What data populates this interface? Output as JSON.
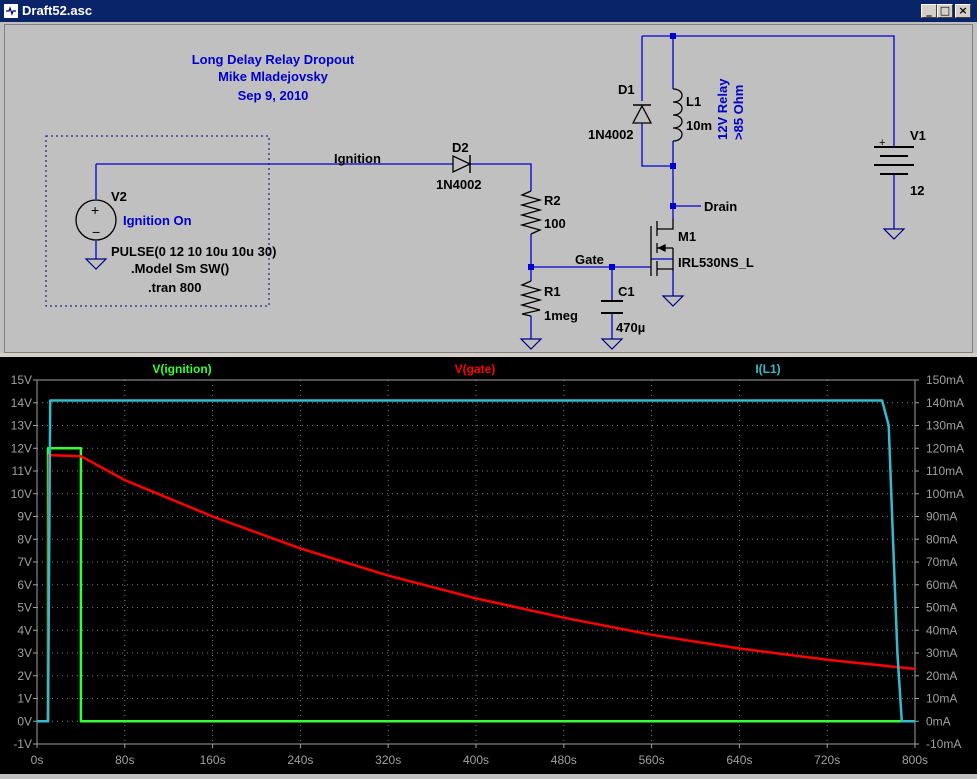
{
  "window": {
    "title": "Draft52.asc",
    "buttons": [
      "_",
      "□",
      "×"
    ]
  },
  "schematic": {
    "notes": [
      "Long Delay Relay Dropout",
      "Mike Mladejovsky",
      "Sep 9, 2010"
    ],
    "directives": [
      "PULSE(0 12 10 10u 10u 30)",
      ".Model Sm SW()",
      ".tran 800"
    ],
    "nets": {
      "ignition": "Ignition",
      "gate": "Gate",
      "drain": "Drain"
    },
    "components": {
      "v2": {
        "name": "V2",
        "label": "Ignition On"
      },
      "d2": {
        "name": "D2",
        "value": "1N4002"
      },
      "r2": {
        "name": "R2",
        "value": "100"
      },
      "r1": {
        "name": "R1",
        "value": "1meg"
      },
      "c1": {
        "name": "C1",
        "value": "470µ"
      },
      "m1": {
        "name": "M1",
        "value": "IRL530NS_L"
      },
      "d1": {
        "name": "D1",
        "value": "1N4002"
      },
      "l1": {
        "name": "L1",
        "value": "10m"
      },
      "relay_note": [
        "12V Relay",
        ">85 Ohm"
      ],
      "v1": {
        "name": "V1",
        "value": "12",
        "plus": "+"
      }
    }
  },
  "chart_data": {
    "type": "line",
    "x": {
      "unit": "s",
      "range": [
        0,
        800
      ],
      "ticks": [
        "0s",
        "80s",
        "160s",
        "240s",
        "320s",
        "400s",
        "480s",
        "560s",
        "640s",
        "720s",
        "800s"
      ]
    },
    "y_left": {
      "range": [
        -1,
        15
      ],
      "ticks": [
        "-1V",
        "0V",
        "1V",
        "2V",
        "3V",
        "4V",
        "5V",
        "6V",
        "7V",
        "8V",
        "9V",
        "10V",
        "11V",
        "12V",
        "13V",
        "14V",
        "15V"
      ]
    },
    "y_right": {
      "range": [
        -10,
        150
      ],
      "ticks": [
        "-10mA",
        "0mA",
        "10mA",
        "20mA",
        "30mA",
        "40mA",
        "50mA",
        "60mA",
        "70mA",
        "80mA",
        "90mA",
        "100mA",
        "110mA",
        "120mA",
        "130mA",
        "140mA",
        "150mA"
      ]
    },
    "grid": true,
    "series": [
      {
        "name": "V(ignition)",
        "color": "#33ff33",
        "axis": "left",
        "x": [
          0,
          10,
          10.01,
          40,
          40.01,
          800
        ],
        "y": [
          0,
          0,
          12,
          12,
          0,
          0
        ]
      },
      {
        "name": "V(gate)",
        "color": "#ff0000",
        "axis": "left",
        "x": [
          0,
          10,
          11,
          40,
          80,
          160,
          240,
          320,
          400,
          480,
          560,
          640,
          720,
          800
        ],
        "y": [
          0,
          0,
          11.7,
          11.65,
          10.6,
          9.0,
          7.6,
          6.4,
          5.4,
          4.55,
          3.8,
          3.2,
          2.7,
          2.3
        ]
      },
      {
        "name": "I(L1)",
        "color": "#33bbcc",
        "axis": "right",
        "x": [
          0,
          10,
          12,
          770,
          776,
          780,
          784,
          788,
          800
        ],
        "y": [
          0,
          0,
          141,
          141,
          130,
          80,
          30,
          0,
          0
        ]
      }
    ]
  }
}
